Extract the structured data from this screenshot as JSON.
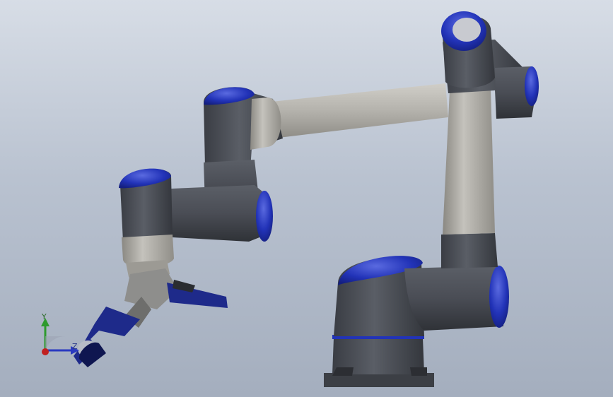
{
  "viewport": {
    "background_top": "#d7dde6",
    "background_bottom": "#a4aebe"
  },
  "colors": {
    "joint_cap_blue": "#2233b8",
    "housing_dark_grey": "#4a4d55",
    "tube_light_grey": "#b4b2ac",
    "gripper_blue": "#1e2a8a"
  },
  "triad": {
    "y_label": "Y",
    "z_label": "Z",
    "y_axis_color": "#2e9a2e",
    "z_axis_color": "#2a3ac0",
    "x_axis_color": "#c02020"
  }
}
